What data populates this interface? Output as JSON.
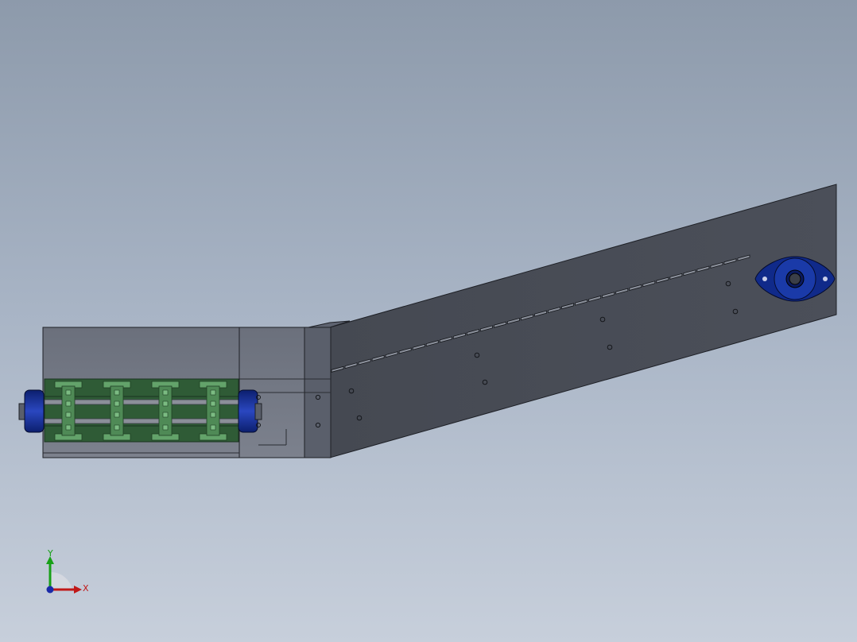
{
  "colors": {
    "background_top": "#8d9aab",
    "background_bottom": "#c7cfdb",
    "body_dark": "#474b55",
    "body_mid": "#5a5f6b",
    "body_light": "#747985",
    "chain_green": "#2f5b36",
    "link_green": "#63a36a",
    "bearing_blue": "#102a8a",
    "axis_x": "#c01818",
    "axis_y": "#17a017",
    "axis_z": "#1a2aa8"
  },
  "triad": {
    "x_label": "X",
    "y_label": "Y"
  },
  "icons": [
    "coordinate-triad-icon"
  ]
}
